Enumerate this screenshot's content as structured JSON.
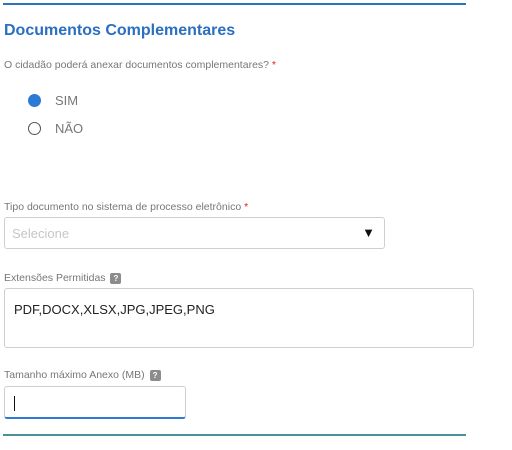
{
  "section": {
    "title": "Documentos Complementares"
  },
  "attach_question": {
    "label": "O cidadão poderá anexar documentos complementares?",
    "required_mark": "*",
    "options": [
      {
        "label": "SIM",
        "selected": true
      },
      {
        "label": "NÃO",
        "selected": false
      }
    ]
  },
  "tipo_documento": {
    "label": "Tipo documento no sistema de processo eletrônico",
    "required_mark": "*",
    "placeholder": "Selecione",
    "arrow_icon": "▼"
  },
  "extensoes": {
    "label": "Extensões Permitidas",
    "help_icon": "?",
    "value": "PDF,DOCX,XLSX,JPG,JPEG,PNG"
  },
  "tamanho": {
    "label": "Tamanho máximo Anexo (MB)",
    "help_icon": "?",
    "value": ""
  },
  "colors": {
    "accent": "#2d7ad6",
    "title": "#2a6fc0",
    "required": "#e02020"
  }
}
